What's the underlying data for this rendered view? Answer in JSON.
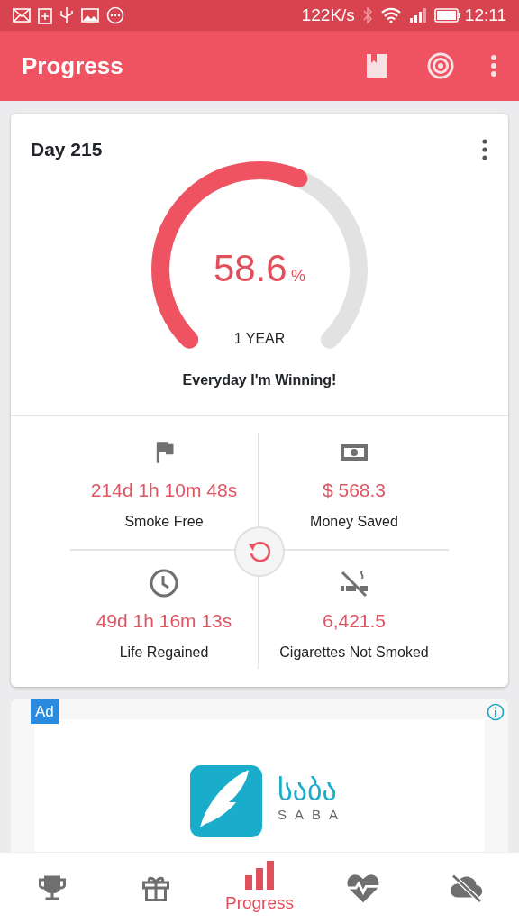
{
  "status_bar": {
    "speed": "122K/s",
    "time": "12:11"
  },
  "app_bar": {
    "title": "Progress"
  },
  "progress_card": {
    "day": "Day 215",
    "percent": "58.6",
    "percent_sign": "%",
    "goal": "1 YEAR",
    "motto": "Everyday I'm Winning!"
  },
  "stats": [
    {
      "kind": "flag",
      "value": "214d 1h 10m 48s",
      "label": "Smoke Free"
    },
    {
      "kind": "money",
      "value": "$ 568.3",
      "label": "Money Saved"
    },
    {
      "kind": "clock",
      "value": "49d 1h 16m 13s",
      "label": "Life Regained"
    },
    {
      "kind": "no-smoking",
      "value": "6,421.5",
      "label": "Cigarettes Not Smoked"
    }
  ],
  "ad": {
    "badge": "Ad",
    "brand_script": "საბა",
    "brand_latin": "SABA"
  },
  "bottom_nav": [
    {
      "kind": "trophy",
      "selected": false
    },
    {
      "kind": "gift",
      "selected": false
    },
    {
      "kind": "chart",
      "label": "Progress",
      "selected": true
    },
    {
      "kind": "heart",
      "selected": false
    },
    {
      "kind": "cloud-off",
      "selected": false
    }
  ]
}
